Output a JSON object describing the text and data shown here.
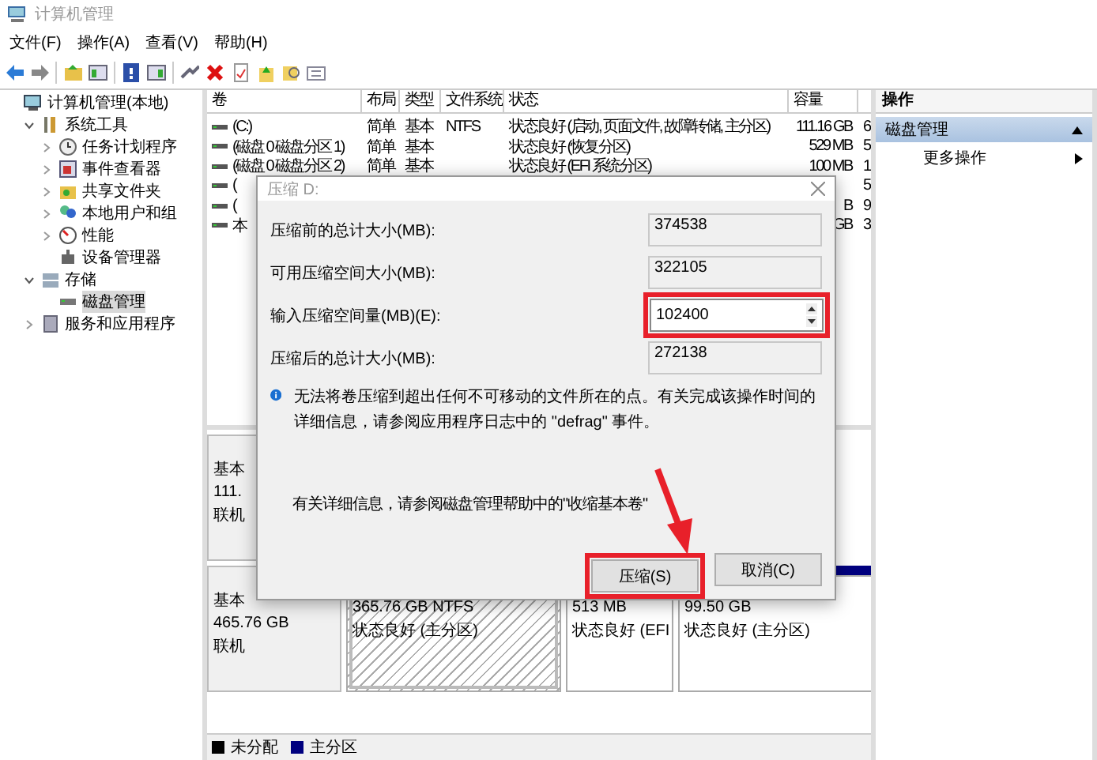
{
  "window": {
    "title": "计算机管理"
  },
  "menu": [
    "文件(F)",
    "操作(A)",
    "查看(V)",
    "帮助(H)"
  ],
  "tree": [
    {
      "label": "计算机管理(本地)",
      "selected": false,
      "children": [
        {
          "label": "系统工具",
          "expanded": true,
          "selected": false,
          "children": [
            {
              "label": "任务计划程序",
              "expanded": false,
              "selected": false
            },
            {
              "label": "事件查看器",
              "expanded": false,
              "selected": false
            },
            {
              "label": "共享文件夹",
              "expanded": false,
              "selected": false
            },
            {
              "label": "本地用户和组",
              "expanded": false,
              "selected": false
            },
            {
              "label": "性能",
              "expanded": false,
              "selected": false
            },
            {
              "label": "设备管理器",
              "selected": false
            }
          ]
        },
        {
          "label": "存储",
          "expanded": true,
          "selected": false,
          "children": [
            {
              "label": "磁盘管理",
              "selected": true
            }
          ]
        },
        {
          "label": "服务和应用程序",
          "expanded": false,
          "selected": false
        }
      ]
    }
  ],
  "table": {
    "columns": [
      "卷",
      "布局",
      "类型",
      "文件系统",
      "状态",
      "容量"
    ],
    "rows": [
      [
        "(C:)",
        "简单",
        "基本",
        "NTFS",
        "状态良好 (启动, 页面文件, 故障转储, 主分区)",
        "111.16 GB",
        "6"
      ],
      [
        "(磁盘 0 磁盘分区 1)",
        "简单",
        "基本",
        null,
        "状态良好 (恢复分区)",
        "529 MB",
        "5"
      ],
      [
        "(磁盘 0 磁盘分区 2)",
        "简单",
        "基本",
        null,
        "状态良好 (EFI 系统分区)",
        "100 MB",
        "1"
      ],
      [
        "(",
        null,
        null,
        null,
        null,
        null,
        "5"
      ],
      [
        "(",
        null,
        null,
        null,
        null,
        "B",
        "9"
      ],
      [
        "本",
        null,
        null,
        null,
        null,
        "GB",
        "3"
      ]
    ]
  },
  "disks": [
    {
      "lines": [
        "基本",
        "111.",
        "联机"
      ]
    },
    {
      "lines": [
        "基本",
        "465.76 GB",
        "联机"
      ],
      "partitions": [
        {
          "size": "365.76 GB NTFS",
          "status": "状态良好 (主分区)",
          "selected": true
        },
        {
          "size": "513 MB",
          "status": "状态良好 (EFI",
          "selected": false
        },
        {
          "size": "99.50 GB",
          "status": "状态良好 (主分区)",
          "selected": false
        }
      ]
    }
  ],
  "legend": [
    {
      "label": "未分配",
      "color": "#000000"
    },
    {
      "label": "主分区",
      "color": "#00007f"
    }
  ],
  "actions": {
    "header": "操作",
    "items": [
      {
        "label": "磁盘管理",
        "kind": "section",
        "expanded": true
      },
      {
        "label": "更多操作",
        "kind": "submenu"
      }
    ]
  },
  "dialog": {
    "title": "压缩 D:",
    "fields": [
      {
        "label": "压缩前的总计大小(MB):",
        "value": "374538",
        "kind": "readonly",
        "highlighted": false
      },
      {
        "label": "可用压缩空间大小(MB):",
        "value": "322105",
        "kind": "readonly",
        "highlighted": false
      },
      {
        "label": "输入压缩空间量(MB)(E):",
        "value": "102400",
        "kind": "spin",
        "highlighted": true
      },
      {
        "label": "压缩后的总计大小(MB):",
        "value": "272138",
        "kind": "readonly",
        "highlighted": false
      }
    ],
    "info": "无法将卷压缩到超出任何不可移动的文件所在的点。有关完成该操作时间的详细信息，请参阅应用程序日志中的 \"defrag\" 事件。",
    "help": "有关详细信息，请参阅磁盘管理帮助中的\"收缩基本卷\"",
    "buttons": [
      {
        "label": "压缩(S)",
        "highlighted": true
      },
      {
        "label": "取消(C)",
        "highlighted": false
      }
    ]
  }
}
